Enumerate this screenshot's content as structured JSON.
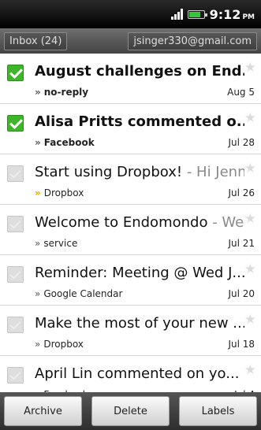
{
  "status_bar": {
    "time": "9:12",
    "ampm": "PM",
    "battery_level": 0.75,
    "signal_icon": "signal-icon",
    "battery_icon": "battery-icon"
  },
  "header": {
    "inbox_label": "Inbox (24)",
    "account": "jsinger330@gmail.com"
  },
  "messages": [
    {
      "subject": "August challenges on End...",
      "snippet": "",
      "sender": "no-reply",
      "date": "Aug 5",
      "unread": true,
      "checked": true
    },
    {
      "subject": "Alisa Pritts commented o...",
      "snippet": " -...",
      "sender": "Facebook",
      "date": "Jul 28",
      "unread": true,
      "checked": true
    },
    {
      "subject": "Start using Dropbox!",
      "snippet": " - Hi Jenni...",
      "sender": "Dropbox",
      "date": "Jul 26",
      "unread": false,
      "checked": false
    },
    {
      "subject": "Welcome to Endomondo",
      "snippet": " - We...",
      "sender": "service",
      "date": "Jul 21",
      "unread": false,
      "checked": false
    },
    {
      "subject": "Reminder: Meeting @ Wed J...",
      "snippet": "",
      "sender": "Google Calendar",
      "date": "Jul 20",
      "unread": false,
      "checked": false
    },
    {
      "subject": "Make the most of your new ...",
      "snippet": "",
      "sender": "Dropbox",
      "date": "Jul 18",
      "unread": false,
      "checked": false
    },
    {
      "subject": "April Lin commented on yo...",
      "snippet": " -...",
      "sender": "Facebook",
      "date": "Jul 4",
      "unread": false,
      "checked": false
    }
  ],
  "toolbar": {
    "archive_label": "Archive",
    "delete_label": "Delete",
    "labels_label": "Labels"
  },
  "colors": {
    "checked_green": "#3fb52a",
    "header_bg": "#555555"
  }
}
